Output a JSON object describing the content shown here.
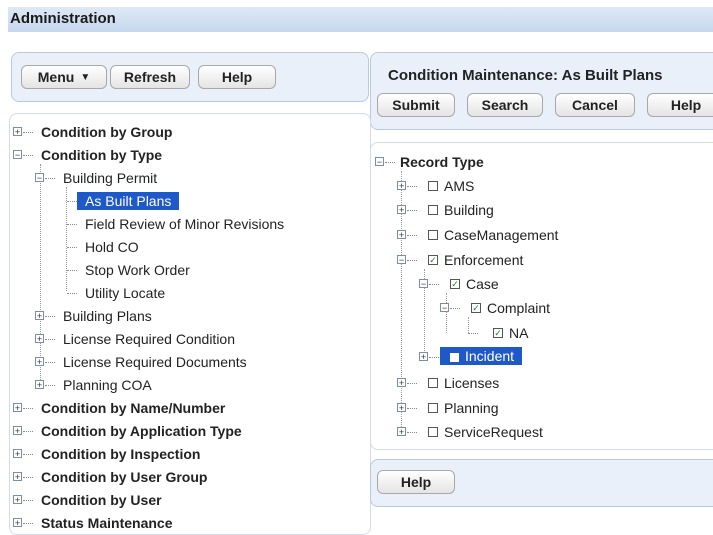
{
  "app_title": "Administration",
  "left_toolbar": {
    "menu_label": "Menu",
    "menu_icon": "dropdown-icon",
    "refresh_label": "Refresh",
    "help_label": "Help"
  },
  "right_header": {
    "title": "Condition Maintenance: As Built Plans",
    "submit_label": "Submit",
    "search_label": "Search",
    "cancel_label": "Cancel",
    "help_label": "Help"
  },
  "left_tree": {
    "condition_by_group": "Condition by Group",
    "condition_by_type": "Condition by Type",
    "building_permit": "Building Permit",
    "as_built_plans": "As Built Plans",
    "field_review": "Field Review of Minor Revisions",
    "hold_co": "Hold CO",
    "stop_work_order": "Stop Work Order",
    "utility_locate": "Utility Locate",
    "building_plans": "Building Plans",
    "license_required_condition": "License Required Condition",
    "license_required_documents": "License Required Documents",
    "planning_coa": "Planning COA",
    "condition_by_name_number": "Condition by Name/Number",
    "condition_by_application_type": "Condition by Application Type",
    "condition_by_inspection": "Condition by Inspection",
    "condition_by_user_group": "Condition by User Group",
    "condition_by_user": "Condition by User",
    "status_maintenance": "Status Maintenance"
  },
  "record_tree": {
    "root": "Record Type",
    "ams": "AMS",
    "building": "Building",
    "case_management": "CaseManagement",
    "enforcement": "Enforcement",
    "case": "Case",
    "complaint": "Complaint",
    "na": "NA",
    "incident": "Incident",
    "licenses": "Licenses",
    "planning": "Planning",
    "service_request": "ServiceRequest"
  },
  "bottom_help_label": "Help",
  "colors": {
    "selection": "#1f58c7",
    "panel": "#e9f0fa",
    "titlebar": "#c6d7ee"
  }
}
